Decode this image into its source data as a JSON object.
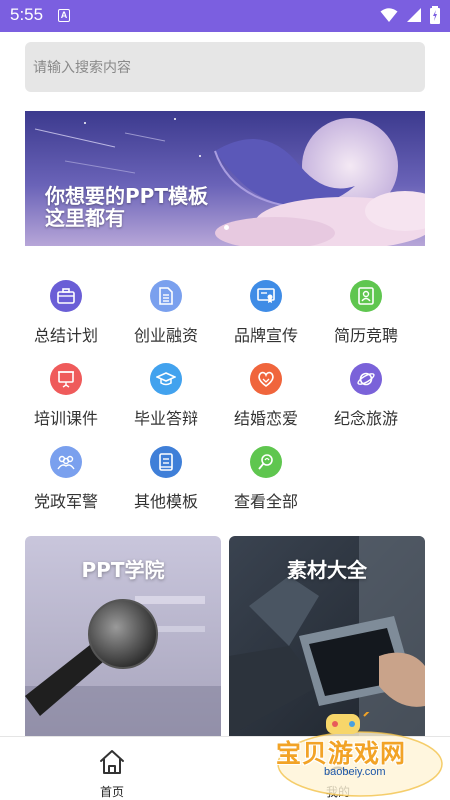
{
  "status_bar": {
    "time": "5:55",
    "notification_icon": "A"
  },
  "search": {
    "placeholder": "请输入搜索内容"
  },
  "banner": {
    "line1": "你想要的PPT模板",
    "line2": "这里都有"
  },
  "categories": [
    {
      "label": "总结计划",
      "icon": "briefcase-icon",
      "color": "#6a5ed6"
    },
    {
      "label": "创业融资",
      "icon": "document-icon",
      "color": "#7aa0ee"
    },
    {
      "label": "品牌宣传",
      "icon": "certificate-icon",
      "color": "#3f8ce6"
    },
    {
      "label": "简历竞聘",
      "icon": "resume-icon",
      "color": "#5fc64f"
    },
    {
      "label": "培训课件",
      "icon": "presentation-icon",
      "color": "#ef5b5b"
    },
    {
      "label": "毕业答辩",
      "icon": "graduation-cap-icon",
      "color": "#42a2ee"
    },
    {
      "label": "结婚恋爱",
      "icon": "heart-icon",
      "color": "#f0653c"
    },
    {
      "label": "纪念旅游",
      "icon": "planet-icon",
      "color": "#7a62d9"
    },
    {
      "label": "党政军警",
      "icon": "group-icon",
      "color": "#7aa0ee"
    },
    {
      "label": "其他模板",
      "icon": "book-icon",
      "color": "#3f7fd8"
    },
    {
      "label": "查看全部",
      "icon": "view-all-icon",
      "color": "#5fc64f"
    }
  ],
  "cards": [
    {
      "title": "PPT学院"
    },
    {
      "title": "素材大全"
    }
  ],
  "bottom_nav": {
    "home": "首页",
    "mine": "我的"
  },
  "watermark": {
    "title": "宝贝游戏网",
    "url": "baobeiy.com"
  },
  "colors": {
    "status_bar": "#7b5fe0",
    "search_bg": "#e6e6e6"
  }
}
